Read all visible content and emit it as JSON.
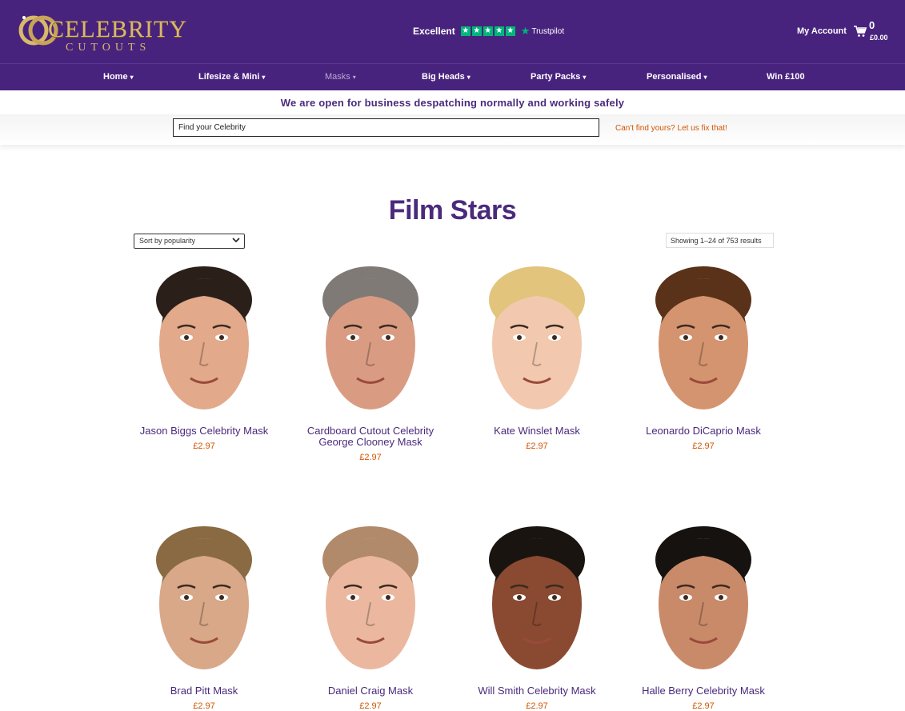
{
  "brand": {
    "main": "CELEBRITY",
    "sub": "CUTOUTS"
  },
  "trustpilot": {
    "rating_label": "Excellent",
    "brand": "Trustpilot",
    "star_glyph": "★"
  },
  "account": {
    "label": "My Account"
  },
  "cart": {
    "count": "0",
    "total": "£0.00"
  },
  "nav": [
    {
      "label": "Home",
      "chev": "▾"
    },
    {
      "label": "Lifesize & Mini",
      "chev": "▾"
    },
    {
      "label": "Masks",
      "chev": "▾"
    },
    {
      "label": "Big Heads",
      "chev": "▾"
    },
    {
      "label": "Party Packs",
      "chev": "▾"
    },
    {
      "label": "Personalised",
      "chev": "▾"
    },
    {
      "label": "Win £100",
      "chev": ""
    }
  ],
  "notice": "We are open for business despatching normally and working safely",
  "search": {
    "value": "Find your Celebrity",
    "cant_find": "Can't find yours? Let us fix that!"
  },
  "page": {
    "title": "Film Stars"
  },
  "sort": {
    "selected": "Sort by popularity"
  },
  "results": {
    "text": "Showing 1–24 of 753 results"
  },
  "products": [
    {
      "name": "Jason Biggs Celebrity Mask",
      "price": "£2.97",
      "skin": "#e2a98a",
      "hair": "#2b1f19"
    },
    {
      "name": "Cardboard Cutout Celebrity George Clooney Mask",
      "price": "£2.97",
      "skin": "#d99c82",
      "hair": "#7f7a76"
    },
    {
      "name": "Kate Winslet Mask",
      "price": "£2.97",
      "skin": "#f2c9ae",
      "hair": "#e2c47d"
    },
    {
      "name": "Leonardo DiCaprio Mask",
      "price": "£2.97",
      "skin": "#d49470",
      "hair": "#5a3219"
    },
    {
      "name": "Brad Pitt Mask",
      "price": "£2.97",
      "skin": "#d8a888",
      "hair": "#8a6a43"
    },
    {
      "name": "Daniel Craig Mask",
      "price": "£2.97",
      "skin": "#ebb89f",
      "hair": "#b08a6a"
    },
    {
      "name": "Will Smith Celebrity Mask",
      "price": "£2.97",
      "skin": "#8a4a32",
      "hair": "#1a1411"
    },
    {
      "name": "Halle Berry Celebrity Mask",
      "price": "£2.97",
      "skin": "#c98a6a",
      "hair": "#161210"
    }
  ]
}
